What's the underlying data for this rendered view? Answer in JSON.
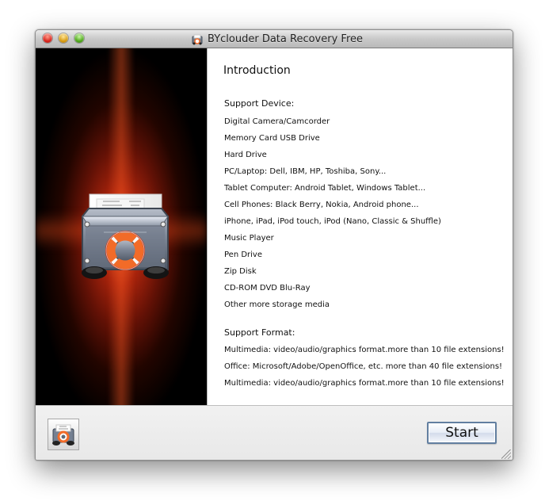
{
  "window": {
    "title": "BYclouder Data Recovery Free",
    "app_icon": "data-recovery-box-icon"
  },
  "hero": {
    "illustration_icon": "data-recovery-box-icon",
    "background_glow": "#e0431c"
  },
  "content": {
    "title": "Introduction",
    "support_device_heading": "Support Device:",
    "support_devices": [
      "Digital Camera/Camcorder",
      "Memory Card USB Drive",
      "Hard Drive",
      "PC/Laptop: Dell, IBM, HP, Toshiba, Sony...",
      "Tablet Computer: Android Tablet, Windows Tablet...",
      "Cell Phones: Black Berry, Nokia, Android phone...",
      "iPhone, iPad, iPod touch, iPod (Nano, Classic & Shuffle)",
      "Music Player",
      "Pen Drive",
      "Zip Disk",
      "CD-ROM DVD Blu-Ray",
      "Other more storage media"
    ],
    "support_format_heading": "Support Format:",
    "support_formats": [
      "Multimedia: video/audio/graphics format.more than 10 file extensions!",
      "Office: Microsoft/Adobe/OpenOffice, etc. more than 40 file extensions!",
      "Multimedia: video/audio/graphics format.more than 10 file extensions!"
    ]
  },
  "footer": {
    "icon": "data-recovery-box-icon",
    "start_label": "Start",
    "start_button_border": "#627fa0"
  },
  "colors": {
    "window_background": "#ececec",
    "content_background": "#ffffff",
    "lifebuoy_orange": "#f26b28"
  }
}
